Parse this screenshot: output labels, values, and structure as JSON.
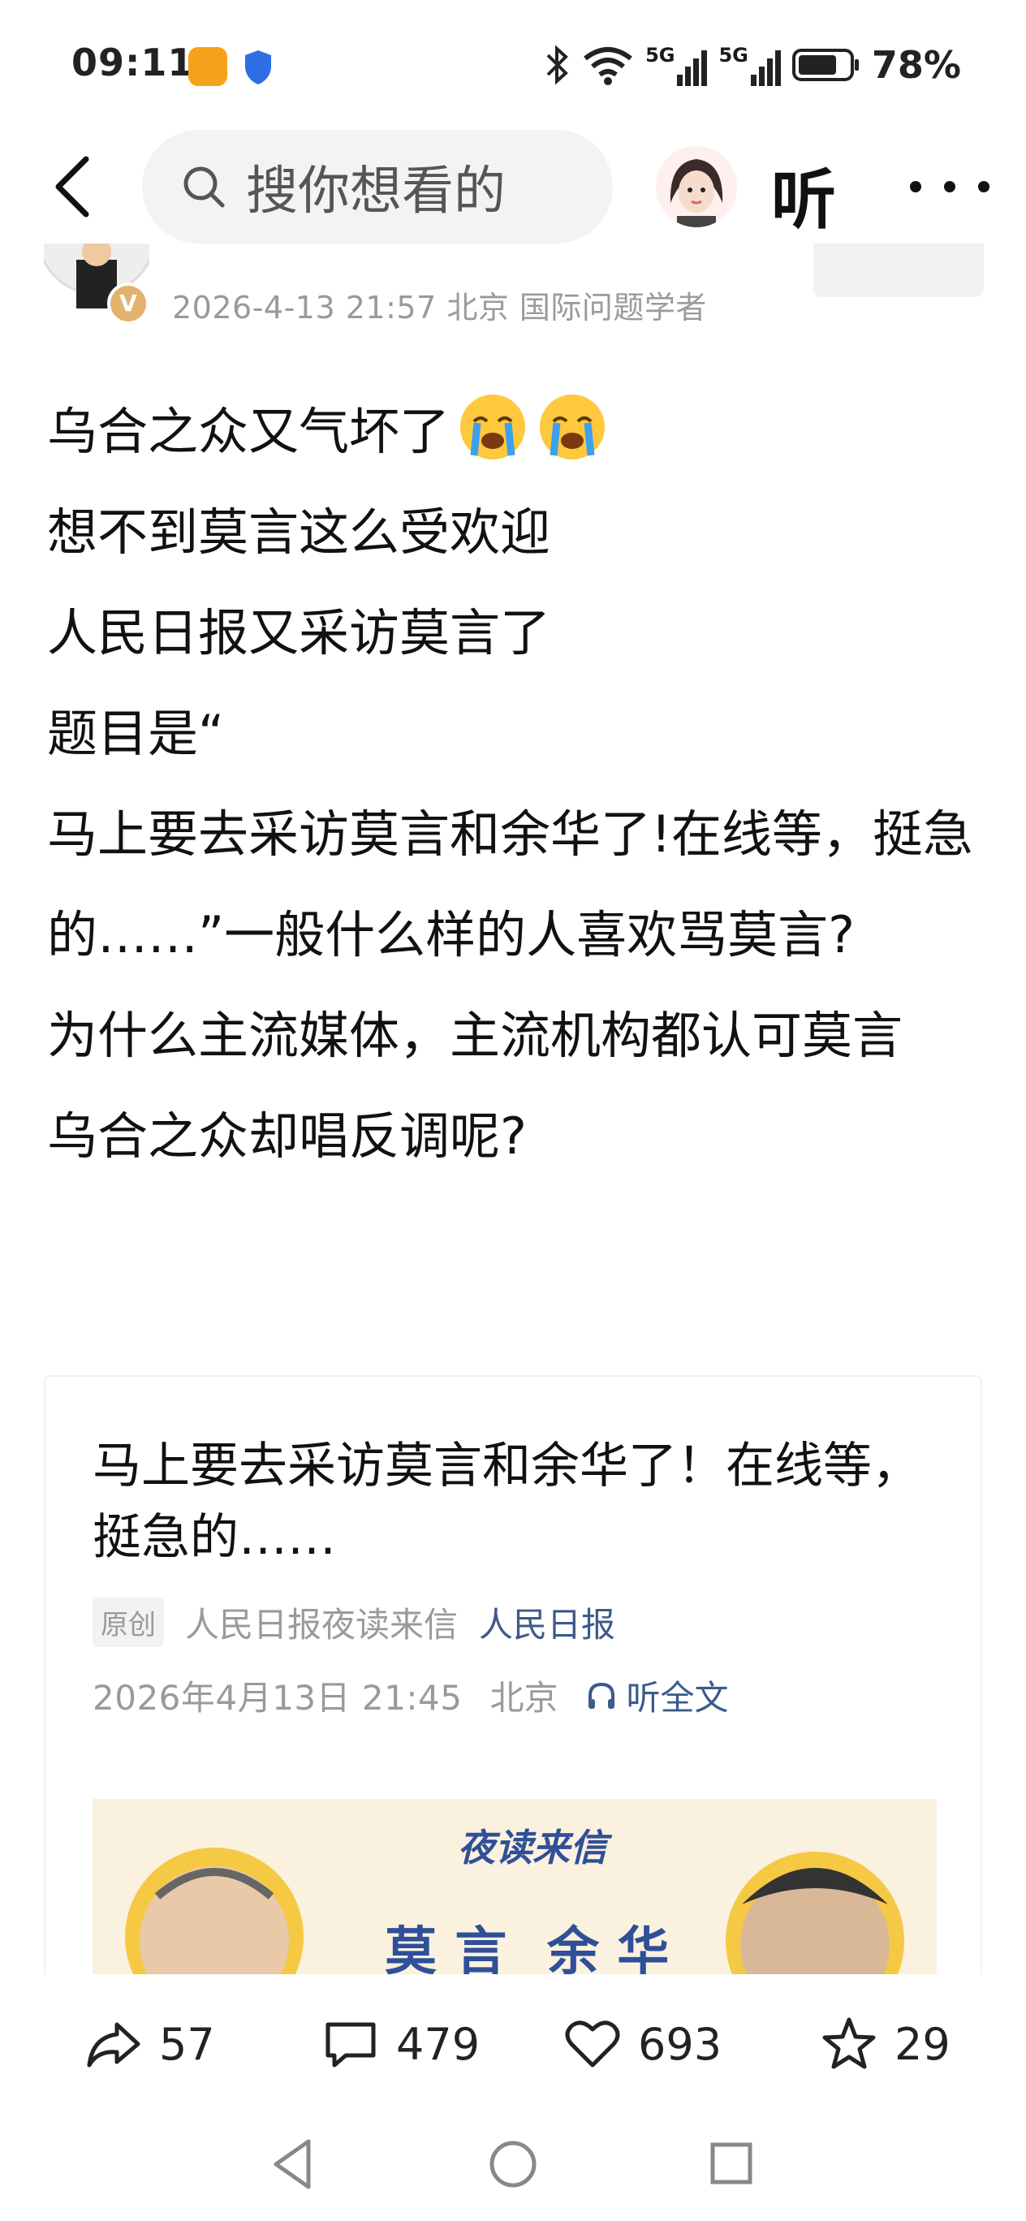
{
  "status_bar": {
    "time": "09:11",
    "battery": "78%",
    "signal_labels": [
      "5G",
      "5G"
    ]
  },
  "nav": {
    "search_placeholder": "搜你想看的",
    "listen_label": "听"
  },
  "author": {
    "meta": "2026-4-13 21:57 北京 国际问题学者",
    "badge": "V"
  },
  "post": {
    "lines": [
      "乌合之众又气坏了",
      "想不到莫言这么受欢迎",
      "人民日报又采访莫言了",
      "题目是“",
      "马上要去采访莫言和余华了!在线等，挺急的……”一般什么样的人喜欢骂莫言?",
      "为什么主流媒体，主流机构都认可莫言",
      "乌合之众却唱反调呢?"
    ]
  },
  "article_card": {
    "title": "马上要去采访莫言和余华了！在线等，挺急的……",
    "original_tag": "原创",
    "source_name": "人民日报夜读来信",
    "source_link": "人民日报",
    "date": "2026年4月13日 21:45",
    "location": "北京",
    "listen_full": "听全文",
    "image_caption": "夜读来信"
  },
  "actions": {
    "share_count": "57",
    "comment_count": "479",
    "like_count": "693",
    "favorite_count": "29"
  },
  "colors": {
    "accent_link": "#3c5a8a",
    "muted_text": "#9a9a9a",
    "search_bg": "#f2f3f5"
  }
}
